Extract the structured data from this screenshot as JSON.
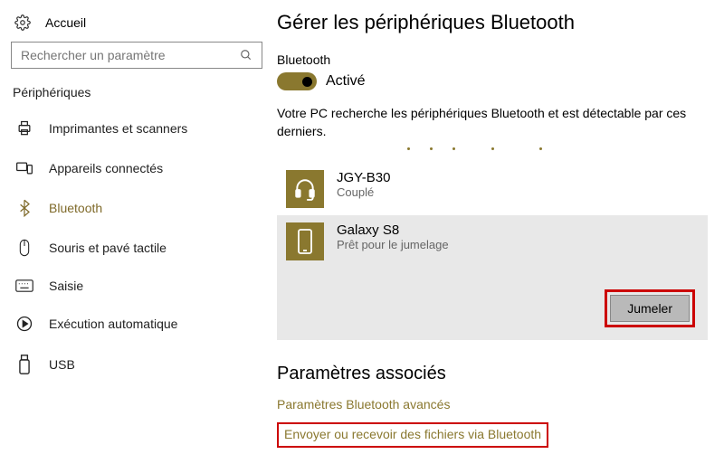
{
  "sidebar": {
    "home": "Accueil",
    "search_placeholder": "Rechercher un paramètre",
    "category": "Périphériques",
    "items": [
      {
        "label": "Imprimantes et scanners"
      },
      {
        "label": "Appareils connectés"
      },
      {
        "label": "Bluetooth"
      },
      {
        "label": "Souris et pavé tactile"
      },
      {
        "label": "Saisie"
      },
      {
        "label": "Exécution automatique"
      },
      {
        "label": "USB"
      }
    ]
  },
  "main": {
    "title": "Gérer les périphériques Bluetooth",
    "bluetooth_label": "Bluetooth",
    "toggle_state": "Activé",
    "description": "Votre PC recherche les périphériques Bluetooth et est détectable par ces derniers.",
    "devices": [
      {
        "name": "JGY-B30",
        "status": "Couplé"
      },
      {
        "name": "Galaxy S8",
        "status": "Prêt pour le jumelage"
      }
    ],
    "pair_button": "Jumeler",
    "related_title": "Paramètres associés",
    "links": [
      "Paramètres Bluetooth avancés",
      "Envoyer ou recevoir des fichiers via Bluetooth"
    ]
  }
}
